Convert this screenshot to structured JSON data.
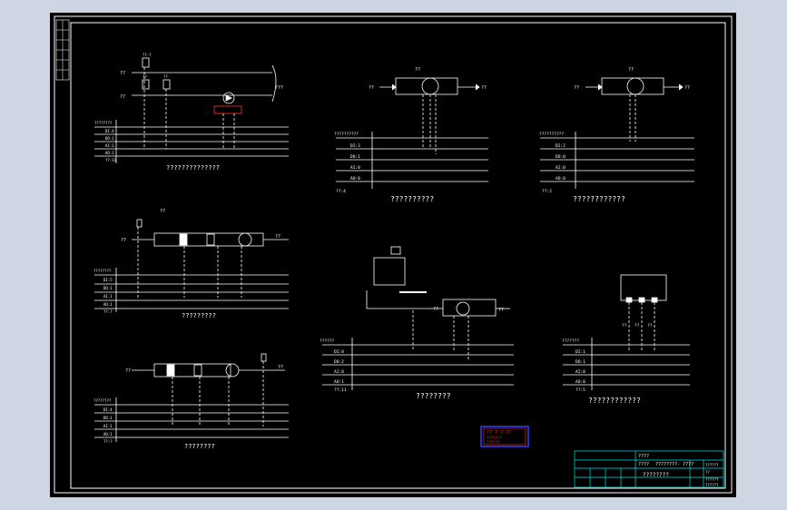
{
  "colors": {
    "paper": "#cfd6e3",
    "sheet": "#000000",
    "line": "#ffffff",
    "cyan": "#00e5e5",
    "yellow": "#ffff33",
    "red": "#ff3030",
    "blue": "#3040ff"
  },
  "panels": {
    "p1": {
      "caption": "??????????????",
      "rows": [
        "????????",
        "DI:4",
        "DO:1",
        "AI:1",
        "AO:1",
        "??:11"
      ],
      "in_label": "??",
      "in_label2": "??",
      "out_label": "???",
      "tag1": "??-?",
      "tag2": "??",
      "tag3": "??"
    },
    "p2": {
      "caption": "??????????",
      "rows": [
        "??????????",
        "DI:3",
        "DO:1",
        "AI:0",
        "AO:0",
        "??:4"
      ],
      "in_label": "??",
      "out_label": "??",
      "top_label": "??"
    },
    "p3": {
      "caption": "????????????",
      "rows": [
        "??????????",
        "DI:2",
        "DO:0",
        "AI:0",
        "AO:0",
        "??:2"
      ],
      "in_label": "??",
      "out_label": "??",
      "top_label": "??"
    },
    "p4": {
      "caption": "?????????",
      "rows": [
        "????????",
        "DI:5",
        "DO:1",
        "AI:1",
        "AO:1",
        "??:?"
      ],
      "in_label": "??",
      "out_label": "??",
      "top_label": "??"
    },
    "p5": {
      "caption": "????????",
      "rows": [
        "??????",
        "DI:8",
        "DO:2",
        "AI:0",
        "AO:1",
        "??:11"
      ],
      "in_label": "??",
      "out_label": "??"
    },
    "p6": {
      "caption": "????????",
      "rows": [
        "????????",
        "DI:4",
        "DO:1",
        "AI:1",
        "AO:1",
        "??:?"
      ],
      "in_label": "??",
      "out_label": "??"
    },
    "p7": {
      "caption": "????????????",
      "rows": [
        "???????",
        "DI:1",
        "DO:1",
        "AI:0",
        "AO:0",
        "??:5"
      ],
      "tags": [
        "??",
        "??",
        "??"
      ]
    }
  },
  "stamp": {
    "line1": "?? ? ? ??",
    "line2": "???????",
    "line3": "??????"
  },
  "title_block": {
    "row1": "????",
    "row2_label": "????",
    "row2_value": "????????- ????",
    "drawing_title": "????????",
    "c1": "??????",
    "c2": "??",
    "c3": "??????",
    "c4": "??????"
  }
}
